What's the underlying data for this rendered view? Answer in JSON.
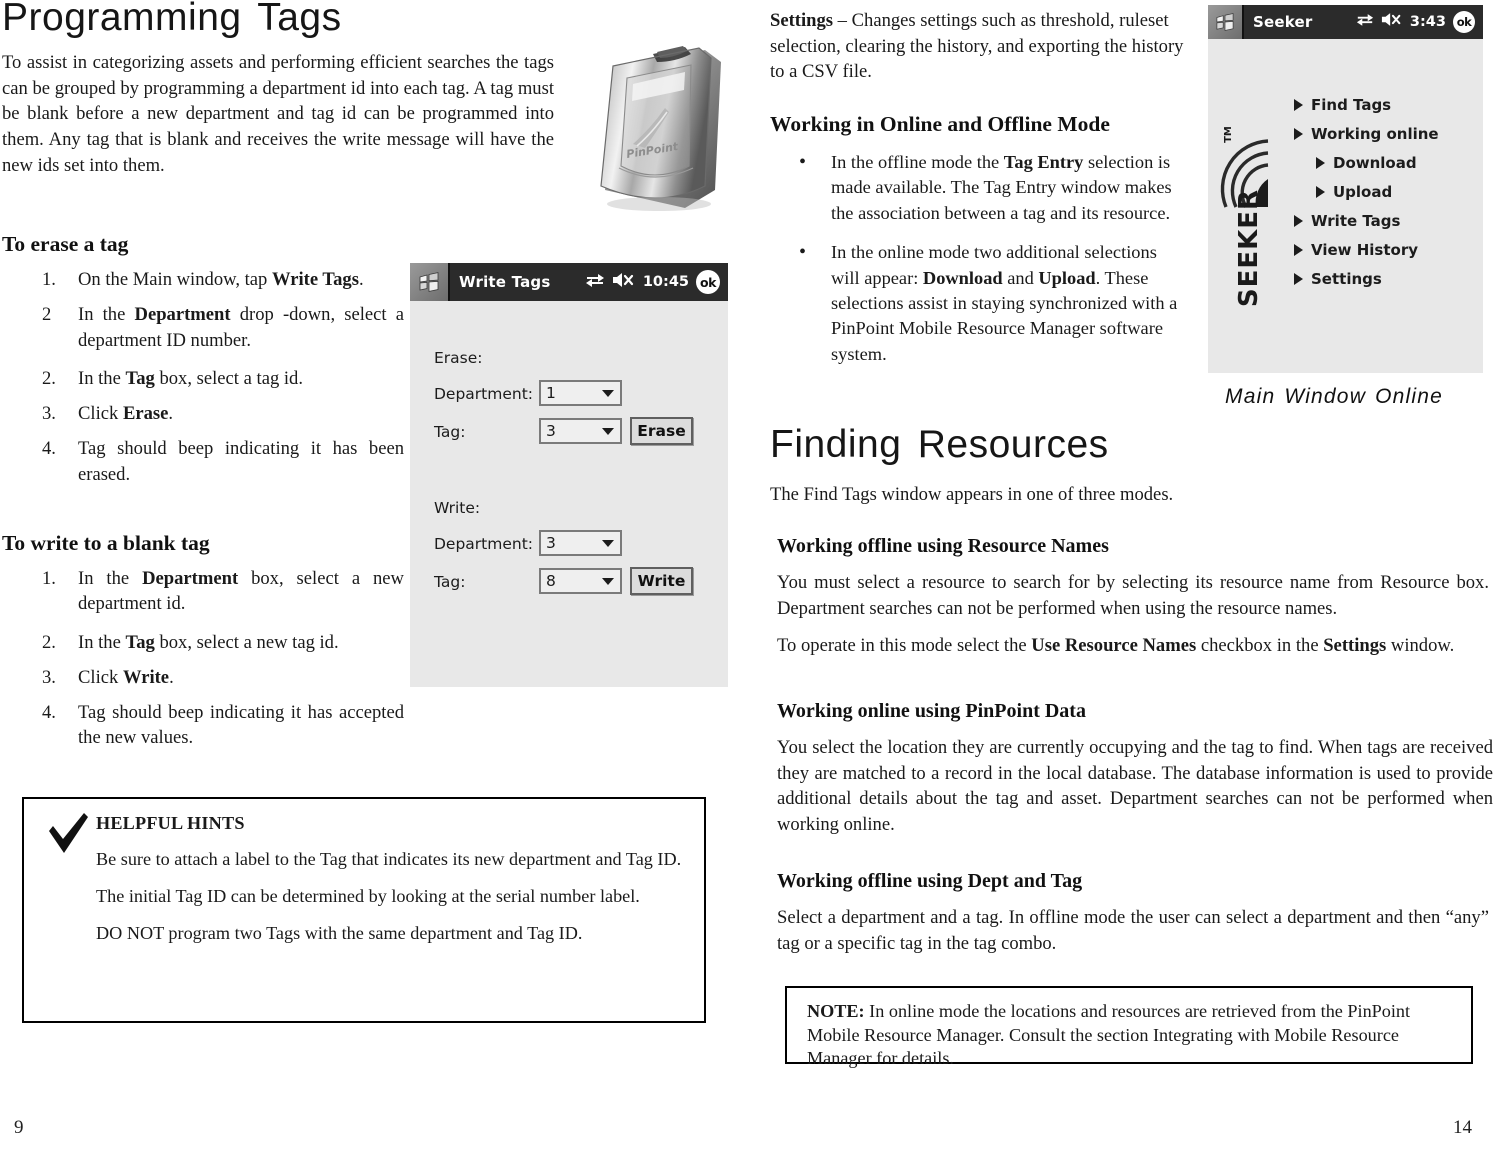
{
  "document": {
    "left_page_number": "9",
    "right_page_number": "14"
  },
  "left_column": {
    "title": "Programming Tags",
    "intro": "To assist in categorizing assets and performing efficient searches the tags can be grouped by programming a department id into each tag.  A tag must be blank before a new department and tag id can be programmed into them.  Any tag that is blank and receives the write message will have the new ids set into them.",
    "section_erase": {
      "heading": "To erase a tag",
      "steps": [
        {
          "num": "1.",
          "html": "On the Main window, tap <b>Write Tags</b>."
        },
        {
          "num": "2",
          "html": "In the <b>Department</b> drop -down, select a department ID number."
        },
        {
          "num": "2.",
          "html": "In the <b>Tag</b> box, select a tag id."
        },
        {
          "num": "3.",
          "html": "Click <b>Erase</b>."
        },
        {
          "num": "4.",
          "html": "Tag should beep indicating it has been erased."
        }
      ]
    },
    "section_write": {
      "heading": "To write to a blank tag",
      "steps": [
        {
          "num": "1.",
          "html": "In the <b>Department</b> box, select a new department id."
        },
        {
          "num": "2.",
          "html": "In the <b>Tag</b> box, select a new tag id."
        },
        {
          "num": "3.",
          "html": "Click <b>Write</b>."
        },
        {
          "num": "4.",
          "html": "Tag should beep indicating it has accepted the new values."
        }
      ]
    },
    "hints_box": {
      "icon": "checkmark-icon",
      "title": "HELPFUL HINTS",
      "paragraphs": [
        "Be sure to attach a label to the Tag that indicates its new department and Tag ID.",
        "The initial Tag ID can be determined by looking at the serial number label.",
        "DO NOT  program two Tags with the same department and Tag ID."
      ]
    },
    "tag_device_image": {
      "alt": "pinpoint-tag-device-photo",
      "brand_text": "PinPoint"
    }
  },
  "write_tags_screenshot": {
    "title": "Write Tags",
    "tray_icons": [
      "connectivity-icon",
      "volume-mute-icon"
    ],
    "clock": "10:45",
    "ok_label": "ok",
    "groups": [
      {
        "label": "Erase:",
        "fields": [
          {
            "label": "Department:",
            "value": "1"
          },
          {
            "label": "Tag:",
            "value": "3"
          }
        ],
        "button": "Erase"
      },
      {
        "label": "Write:",
        "fields": [
          {
            "label": "Department:",
            "value": "3"
          },
          {
            "label": "Tag:",
            "value": "8"
          }
        ],
        "button": "Write"
      }
    ]
  },
  "seeker_screenshot": {
    "title": "Seeker",
    "tray_icons": [
      "connectivity-icon",
      "volume-mute-icon"
    ],
    "clock": "3:43",
    "ok_label": "ok",
    "logo_text": "SEEKER",
    "logo_tm": "TM",
    "menu": [
      {
        "label": "Find Tags",
        "level": 1
      },
      {
        "label": "Working online",
        "level": 1
      },
      {
        "label": "Download",
        "level": 2
      },
      {
        "label": "Upload",
        "level": 2
      },
      {
        "label": "Write Tags",
        "level": 1
      },
      {
        "label": "View History",
        "level": 1
      },
      {
        "label": "Settings",
        "level": 1
      }
    ],
    "caption": "Main Window Online"
  },
  "right_column": {
    "settings_paragraph_html": "<b>Settings</b> &ndash; Changes settings such as threshold, ruleset selection, clearing the history, and exporting the history to a CSV file.",
    "online_offline": {
      "heading": "Working in Online and Offline Mode",
      "bullets": [
        "In the offline mode the <b>Tag Entry</b> selection is made available.  The Tag Entry window makes the association between a tag and its resource.",
        "In the online mode two additional selections will appear: <b>Download</b> and <b>Upload</b>.  These selections assist in staying synchronized with a PinPoint Mobile Resource Manager software system."
      ]
    },
    "finding_resources": {
      "title": "Finding Resources",
      "intro": "The Find Tags window appears in one of three modes.",
      "subsections": [
        {
          "heading": "Working offline using Resource Names",
          "paragraphs": [
            "You must select a resource to search for by selecting its resource name from Resource box.  Department searches can not be performed when using the resource names.",
            "To operate in this mode select the <b>Use Resource Names</b> checkbox in the <b>Settings</b> window."
          ]
        },
        {
          "heading": "Working online using PinPoint Data",
          "paragraphs": [
            "You select the location they are currently occupying and the tag to find.  When tags are received they are matched to a record in the local database.  The database information is used to provide additional details about the tag and asset.  Department searches can not be performed when working online."
          ]
        },
        {
          "heading": "Working offline using Dept and Tag",
          "paragraphs": [
            "Select a department and a tag.  In offline mode the user can select a department and then “any” tag or a specific tag in the tag combo."
          ]
        }
      ]
    },
    "note_box": {
      "html": "<b>NOTE:</b> In online mode the locations and resources are retrieved from the PinPoint Mobile Resource Manager.  Consult the section Integrating with Mobile Resource Manager for details."
    }
  }
}
